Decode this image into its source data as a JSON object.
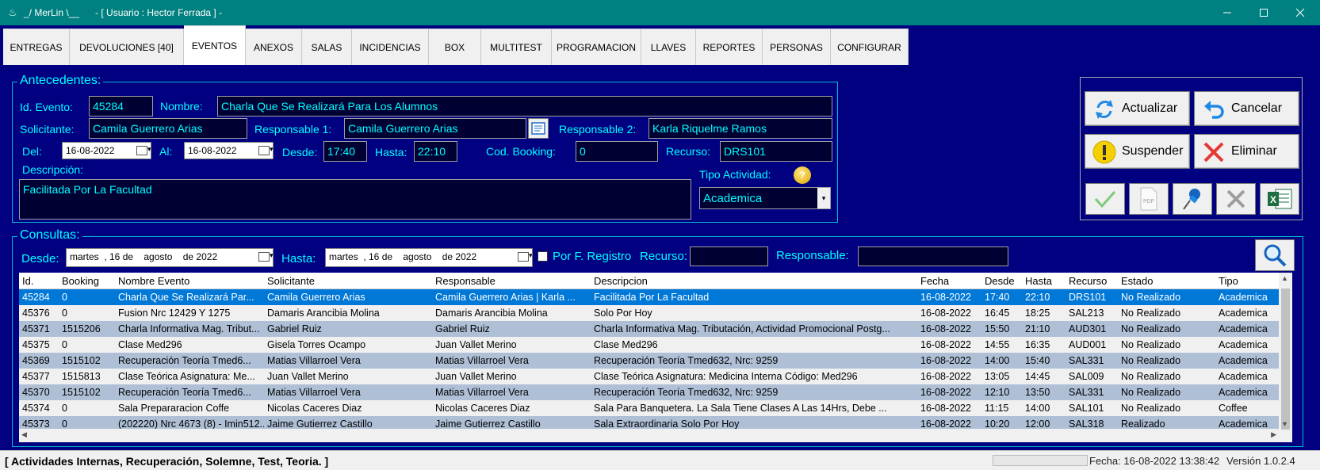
{
  "window": {
    "title": "_/ MerLin \\__      - [ Usuario : Hector Ferrada ] -"
  },
  "tabs": [
    "ENTREGAS",
    "DEVOLUCIONES  [40]",
    "EVENTOS",
    "ANEXOS",
    "SALAS",
    "INCIDENCIAS",
    "BOX",
    "MULTITEST",
    "PROGRAMACION",
    "LLAVES",
    "REPORTES",
    "PERSONAS",
    "CONFIGURAR"
  ],
  "antecedentes": {
    "legend": "Antecedentes:",
    "id_label": "Id. Evento:",
    "id_value": "45284",
    "nombre_label": "Nombre:",
    "nombre_value": "Charla Que Se Realizará Para Los Alumnos",
    "solicitante_label": "Solicitante:",
    "solicitante_value": "Camila Guerrero Arias",
    "resp1_label": "Responsable 1:",
    "resp1_value": "Camila Guerrero Arias",
    "resp2_label": "Responsable 2:",
    "resp2_value": "Karla Riquelme Ramos",
    "del_label": "Del:",
    "del_value": "16-08-2022",
    "al_label": "Al:",
    "al_value": "16-08-2022",
    "desde_label": "Desde:",
    "desde_value": "17:40",
    "hasta_label": "Hasta:",
    "hasta_value": "22:10",
    "booking_label": "Cod. Booking:",
    "booking_value": "0",
    "recurso_label": "Recurso:",
    "recurso_value": "DRS101",
    "descripcion_label": "Descripción:",
    "descripcion_value": "Facilitada Por La Facultad",
    "tipo_label": "Tipo Actividad:",
    "tipo_value": "Academica"
  },
  "actions": {
    "actualizar": "Actualizar",
    "cancelar": "Cancelar",
    "suspender": "Suspender",
    "eliminar": "Eliminar"
  },
  "consultas": {
    "legend": "Consultas:",
    "desde_label": "Desde:",
    "desde_value": "martes  , 16 de    agosto    de 2022",
    "hasta_label": "Hasta:",
    "hasta_value": "martes  , 16 de    agosto    de 2022",
    "por_f_registro": "Por F. Registro",
    "recurso_label": "Recurso:",
    "recurso_value": "",
    "responsable_label": "Responsable:",
    "responsable_value": ""
  },
  "table": {
    "columns": [
      "Id.",
      "Booking",
      "Nombre Evento",
      "Solicitante",
      "Responsable",
      "Descripcion",
      "Fecha",
      "Desde",
      "Hasta",
      "Recurso",
      "Estado",
      "Tipo"
    ],
    "rows": [
      [
        "45284",
        "0",
        "Charla Que Se Realizará Par...",
        "Camila Guerrero Arias",
        "Camila Guerrero Arias | Karla ...",
        "Facilitada Por La Facultad",
        "16-08-2022",
        "17:40",
        "22:10",
        "DRS101",
        "No Realizado",
        "Academica"
      ],
      [
        "45376",
        "0",
        "Fusion Nrc 12429 Y 1275",
        "Damaris Arancibia Molina",
        "Damaris Arancibia Molina",
        "Solo Por Hoy",
        "16-08-2022",
        "16:45",
        "18:25",
        "SAL213",
        "No Realizado",
        "Academica"
      ],
      [
        "45371",
        "1515206",
        "Charla Informativa Mag. Tribut...",
        "Gabriel Ruiz",
        "Gabriel Ruiz",
        "Charla Informativa Mag. Tributación, Actividad Promocional Postg...",
        "16-08-2022",
        "15:50",
        "21:10",
        "AUD301",
        "No Realizado",
        "Academica"
      ],
      [
        "45375",
        "0",
        "Clase Med296",
        "Gisela Torres Ocampo",
        "Juan Vallet Merino",
        "Clase Med296",
        "16-08-2022",
        "14:55",
        "16:35",
        "AUD001",
        "No Realizado",
        "Academica"
      ],
      [
        "45369",
        "1515102",
        "Recuperación Teoría Tmed6...",
        "Matias Villarroel Vera",
        "Matias Villarroel Vera",
        "Recuperación Teoría Tmed632, Nrc: 9259",
        "16-08-2022",
        "14:00",
        "15:40",
        "SAL331",
        "No Realizado",
        "Academica"
      ],
      [
        "45377",
        "1515813",
        "Clase Teórica Asignatura: Me...",
        "Juan Vallet Merino",
        "Juan Vallet Merino",
        "Clase Teórica Asignatura: Medicina Interna Código: Med296",
        "16-08-2022",
        "13:05",
        "14:45",
        "SAL009",
        "No Realizado",
        "Academica"
      ],
      [
        "45370",
        "1515102",
        "Recuperación Teoría Tmed6...",
        "Matias Villarroel Vera",
        "Matias Villarroel Vera",
        "Recuperación Teoría Tmed632, Nrc: 9259",
        "16-08-2022",
        "12:10",
        "13:50",
        "SAL331",
        "No Realizado",
        "Academica"
      ],
      [
        "45374",
        "0",
        "Sala Prepararacion Coffe",
        "Nicolas Caceres Diaz",
        "Nicolas Caceres Diaz",
        "Sala Para Banquetera. La Sala Tiene Clases A Las 14Hrs, Debe ...",
        "16-08-2022",
        "11:15",
        "14:00",
        "SAL101",
        "No Realizado",
        "Coffee"
      ],
      [
        "45373",
        "0",
        "(202220) Nrc 4673 (8) - Imin512...",
        "Jaime Gutierrez Castillo",
        "Jaime Gutierrez Castillo",
        "Sala Extraordinaria Solo Por Hoy",
        "16-08-2022",
        "10:20",
        "12:00",
        "SAL318",
        "Realizado",
        "Academica"
      ]
    ]
  },
  "status": {
    "left": "[ Actividades Internas, Recuperación, Solemne, Test, Teoria. ]",
    "fecha": "Fecha: 16-08-2022 13:38:42",
    "version": "Versión  1.0.2.4"
  }
}
